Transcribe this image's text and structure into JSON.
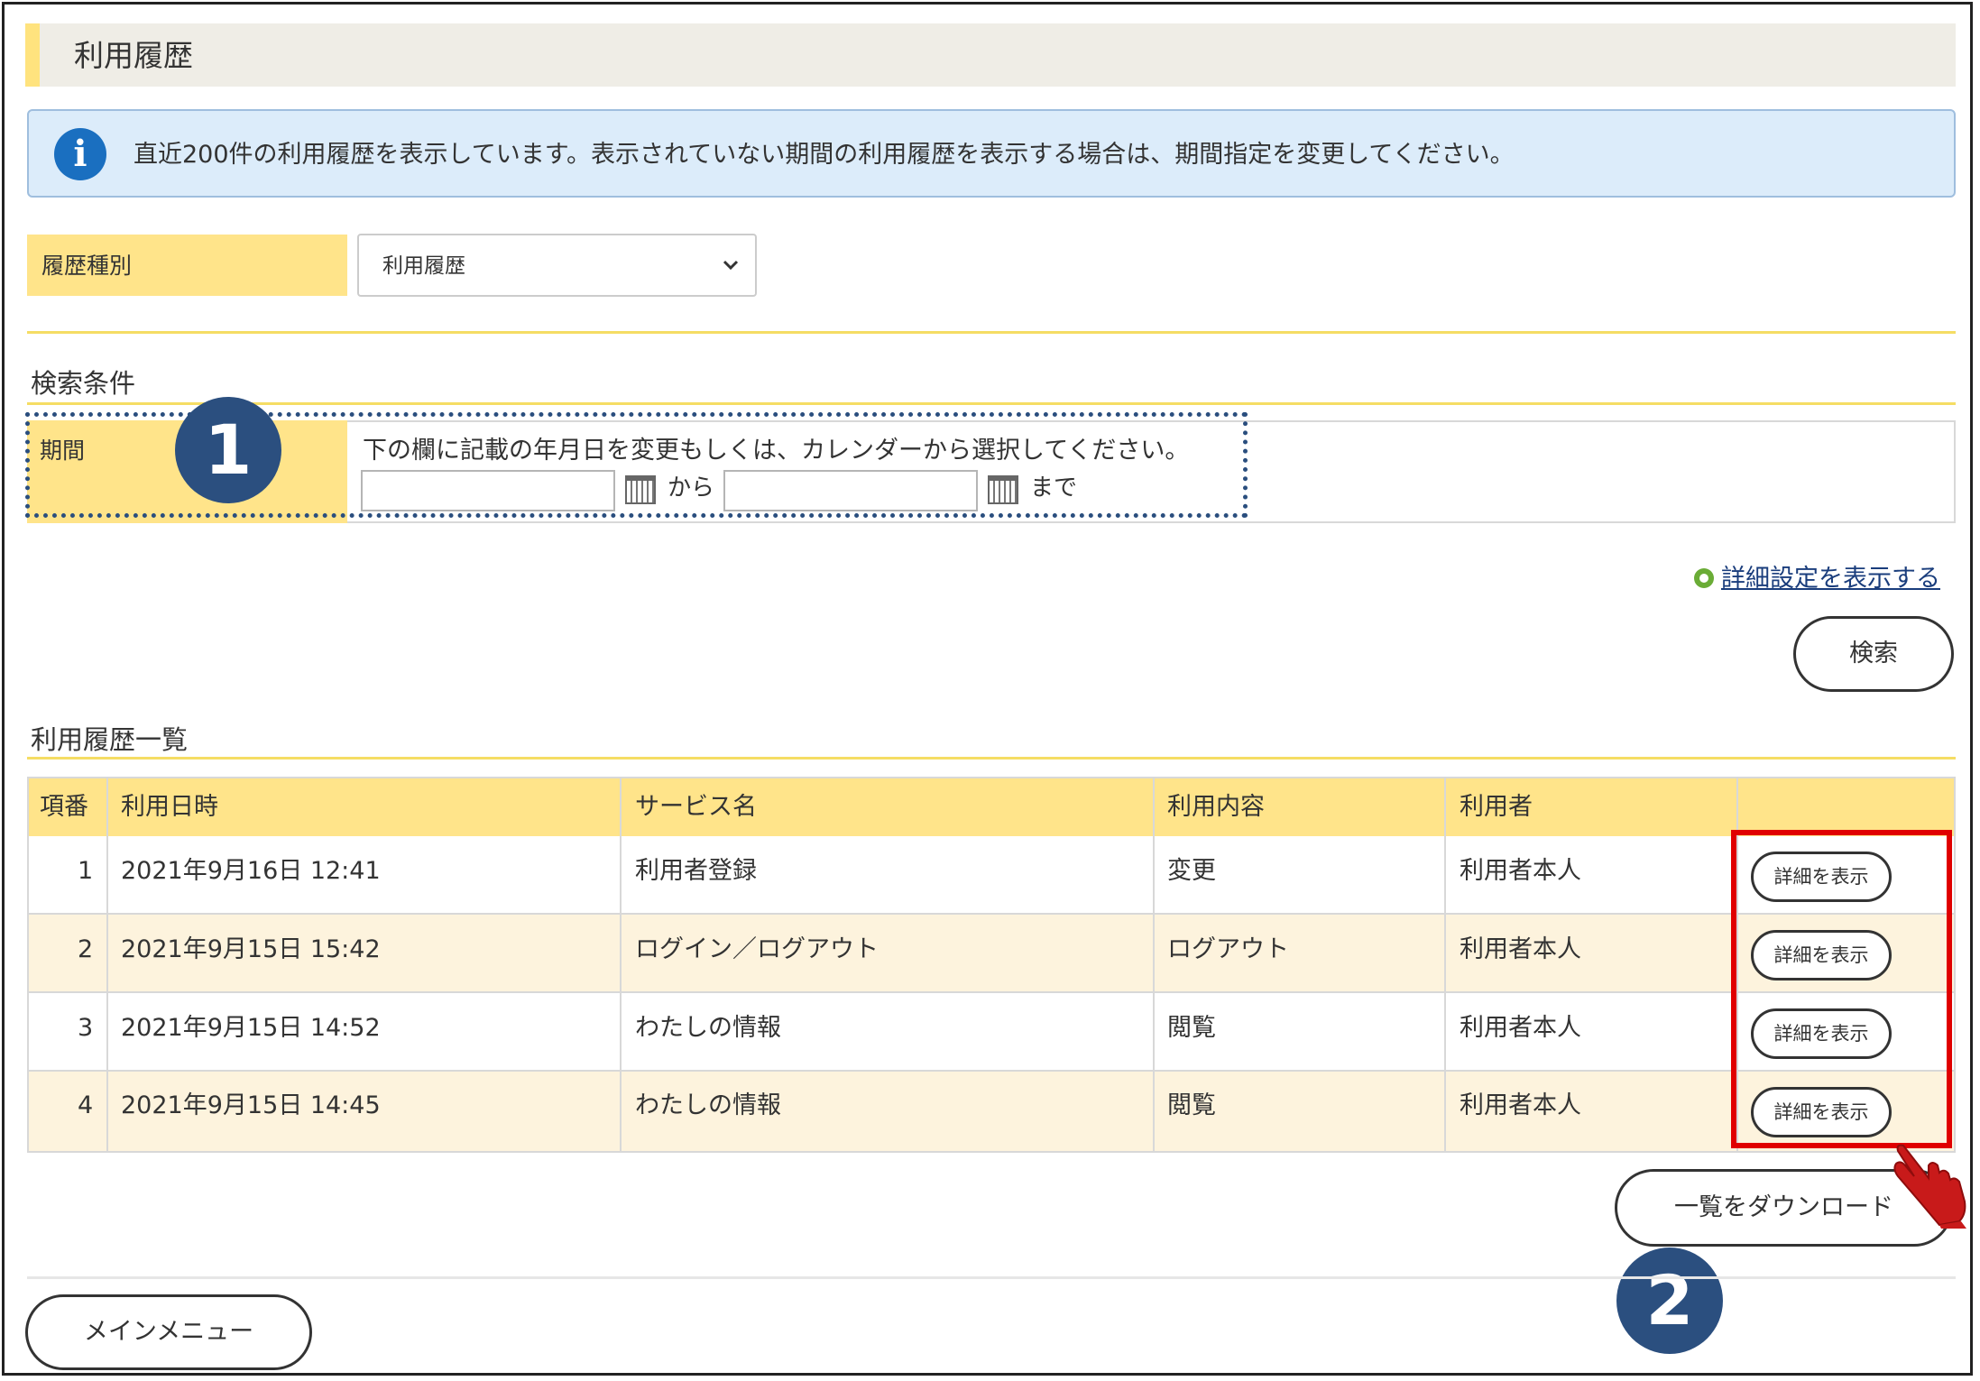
{
  "page": {
    "title": "利用履歴"
  },
  "info": {
    "message": "直近200件の利用履歴を表示しています。表示されていない期間の利用履歴を表示する場合は、期間指定を変更してください。"
  },
  "history_type": {
    "label": "履歴種別",
    "selected": "利用履歴"
  },
  "search": {
    "title": "検索条件",
    "period_label": "期間",
    "hint": "下の欄に記載の年月日を変更もしくは、カレンダーから選択してください。",
    "from_value": "",
    "to_value": "",
    "from_text": "から",
    "to_text": "まで",
    "advanced_link": "詳細設定を表示する",
    "search_button": "検索"
  },
  "list": {
    "title": "利用履歴一覧",
    "headers": [
      "項番",
      "利用日時",
      "サービス名",
      "利用内容",
      "利用者",
      ""
    ],
    "rows": [
      {
        "no": "1",
        "datetime": "2021年9月16日 12:41",
        "service": "利用者登録",
        "content": "変更",
        "user": "利用者本人",
        "action": "詳細を表示"
      },
      {
        "no": "2",
        "datetime": "2021年9月15日 15:42",
        "service": "ログイン／ログアウト",
        "content": "ログアウト",
        "user": "利用者本人",
        "action": "詳細を表示"
      },
      {
        "no": "3",
        "datetime": "2021年9月15日 14:52",
        "service": "わたしの情報",
        "content": "閲覧",
        "user": "利用者本人",
        "action": "詳細を表示"
      },
      {
        "no": "4",
        "datetime": "2021年9月15日 14:45",
        "service": "わたしの情報",
        "content": "閲覧",
        "user": "利用者本人",
        "action": "詳細を表示"
      }
    ],
    "download_button": "一覧をダウンロード"
  },
  "main_menu_button": "メインメニュー",
  "markers": [
    "1",
    "2"
  ],
  "colors": {
    "accent_yellow": "#ffe48a",
    "marker_blue": "#2b4f7f",
    "highlight_red": "#e00000",
    "info_blue": "#1a6fc0"
  },
  "icons": {
    "info": "info-icon",
    "calendar": "calendar-icon",
    "chevron": "chevron-down-icon",
    "advanced": "circle-bullet-icon",
    "pointer": "hand-pointer-icon"
  }
}
